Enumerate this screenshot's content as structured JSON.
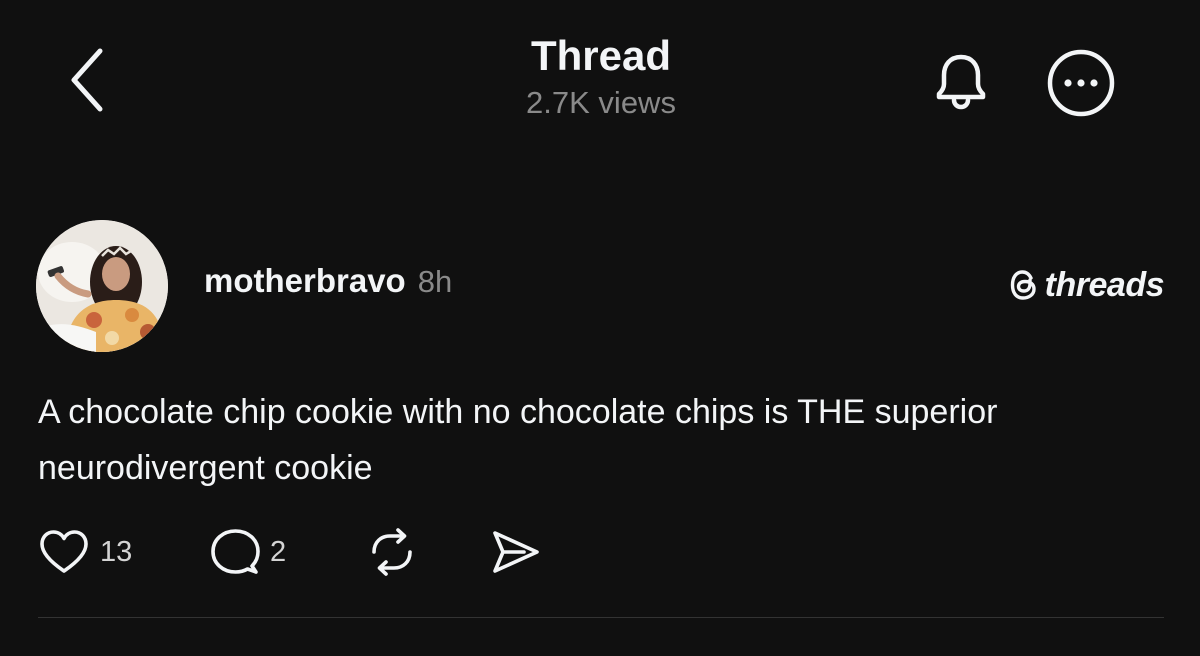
{
  "header": {
    "title": "Thread",
    "views": "2.7K views",
    "icons": {
      "back": "chevron-left-icon",
      "bell": "bell-icon",
      "more": "more-circle-icon"
    }
  },
  "post": {
    "username": "motherbravo",
    "time": "8h",
    "brand": "threads",
    "text": "A chocolate chip cookie with no chocolate chips is THE superior neurodivergent cookie",
    "actions": {
      "likes": "13",
      "replies": "2"
    }
  },
  "colors": {
    "background": "#101010",
    "text": "#f3f5f7",
    "muted": "#8a8a8a",
    "divider": "#333333"
  }
}
